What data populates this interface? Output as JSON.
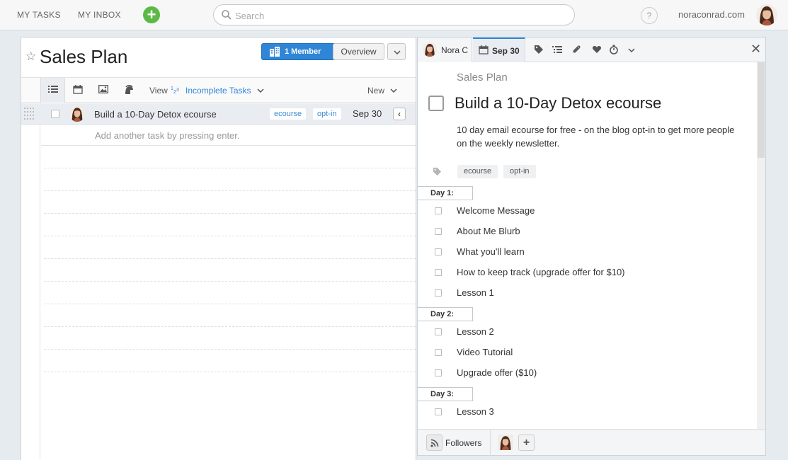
{
  "topbar": {
    "my_tasks": "MY TASKS",
    "my_inbox": "MY INBOX",
    "add_symbol": "+",
    "search_placeholder": "Search",
    "help_symbol": "?",
    "account_name": "noraconrad.com"
  },
  "project": {
    "title": "Sales Plan",
    "member_button": "1 Member",
    "overview_button": "Overview",
    "toolbar": {
      "view_label": "View",
      "view_filter": "Incomplete Tasks",
      "new_label": "New"
    },
    "tasks": [
      {
        "name": "Build a 10-Day Detox ecourse",
        "tags": [
          "ecourse",
          "opt-in"
        ],
        "due": "Sep 30",
        "collapse_symbol": "‹"
      }
    ],
    "add_task_hint": "Add another task by pressing enter."
  },
  "detail": {
    "assignee": "Nora C",
    "due_date": "Sep 30",
    "close_symbol": "✕",
    "project_name": "Sales Plan",
    "title": "Build a 10-Day Detox ecourse",
    "description": "10 day email ecourse for free - on the blog opt-in to get more people on the weekly newsletter.",
    "tags": [
      "ecourse",
      "opt-in"
    ],
    "sections": [
      {
        "label": "Day 1:",
        "items": [
          "Welcome Message",
          "About Me Blurb",
          "What you'll learn",
          "How to keep track (upgrade offer for $10)",
          "Lesson 1"
        ]
      },
      {
        "label": "Day 2:",
        "items": [
          "Lesson 2",
          "Video Tutorial",
          "Upgrade offer ($10)"
        ]
      },
      {
        "label": "Day 3:",
        "items": [
          "Lesson 3"
        ]
      }
    ],
    "followers_label": "Followers",
    "add_follower_symbol": "+"
  },
  "colors": {
    "accent_blue": "#2f86d6",
    "add_green": "#5cb946",
    "background": "#e6ebf0"
  },
  "icons": [
    "search-icon",
    "help-icon",
    "star-icon",
    "building-icon",
    "chevron-down-icon",
    "list-view-icon",
    "calendar-icon",
    "image-icon",
    "spartan-helmet-icon",
    "sort-icon",
    "drag-handle-icon",
    "tag-icon",
    "subtasks-icon",
    "paperclip-icon",
    "heart-icon",
    "stopwatch-icon",
    "close-icon",
    "rss-icon"
  ]
}
